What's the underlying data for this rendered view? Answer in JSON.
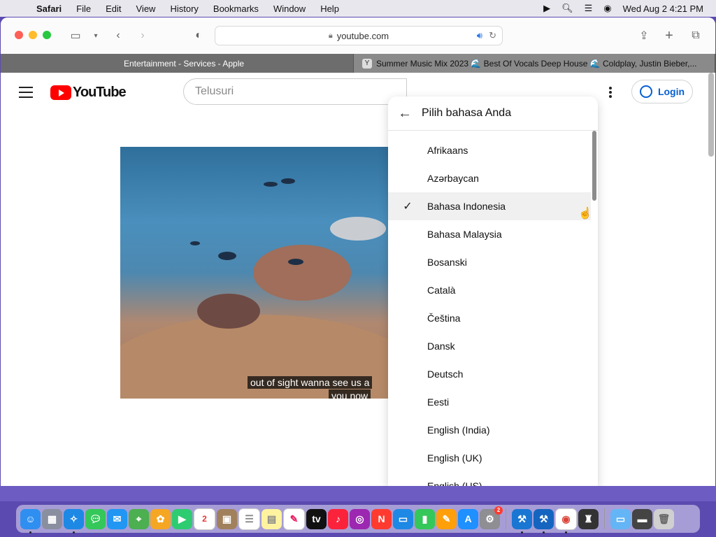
{
  "menubar": {
    "app": "Safari",
    "items": [
      "File",
      "Edit",
      "View",
      "History",
      "Bookmarks",
      "Window",
      "Help"
    ],
    "clock": "Wed Aug 2  4:21 PM"
  },
  "browser": {
    "url": "youtube.com",
    "tabs": [
      {
        "title": "Entertainment - Services - Apple",
        "icon": "apple-icon"
      },
      {
        "title": "Summer Music Mix 2023 🌊 Best Of Vocals Deep House 🌊 Coldplay, Justin Bieber,...",
        "icon": "youtube-favicon"
      }
    ]
  },
  "youtube": {
    "logo_text": "YouTube",
    "search_placeholder": "Telusuri",
    "login_label": "Login",
    "caption_line1": "out of sight wanna see us a",
    "caption_line2": "you now"
  },
  "language_panel": {
    "title": "Pilih bahasa Anda",
    "selected": "Bahasa Indonesia",
    "languages": [
      "Afrikaans",
      "Azərbaycan",
      "Bahasa Indonesia",
      "Bahasa Malaysia",
      "Bosanski",
      "Català",
      "Čeština",
      "Dansk",
      "Deutsch",
      "Eesti",
      "English (India)",
      "English (UK)",
      "English (US)"
    ]
  },
  "dock": {
    "calendar_day": "2",
    "badge": "2"
  }
}
